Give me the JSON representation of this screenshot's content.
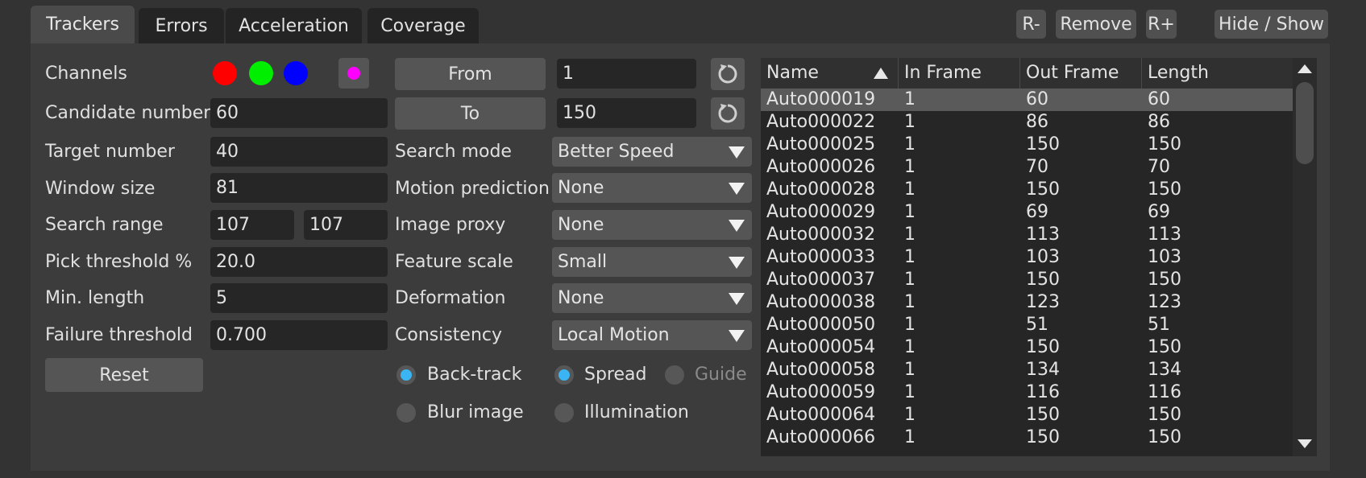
{
  "tabs": [
    {
      "label": "Trackers",
      "active": true
    },
    {
      "label": "Errors",
      "active": false
    },
    {
      "label": "Acceleration",
      "active": false
    },
    {
      "label": "Coverage",
      "active": false
    }
  ],
  "toolbar": {
    "r_minus": "R-",
    "remove": "Remove",
    "r_plus": "R+",
    "hide_show": "Hide / Show"
  },
  "channels": {
    "label": "Channels",
    "colors": [
      "#ff0000",
      "#00ee00",
      "#0000ff"
    ],
    "overlay_color": "#ff00ff"
  },
  "params": {
    "candidate_number": {
      "label": "Candidate number",
      "value": "60"
    },
    "target_number": {
      "label": "Target number",
      "value": "40"
    },
    "window_size": {
      "label": "Window size",
      "value": "81"
    },
    "search_range": {
      "label": "Search range",
      "value_x": "107",
      "value_y": "107"
    },
    "pick_threshold": {
      "label": "Pick threshold %",
      "value": "20.0"
    },
    "min_length": {
      "label": "Min. length",
      "value": "5"
    },
    "failure_threshold": {
      "label": "Failure threshold",
      "value": "0.700"
    },
    "reset_label": "Reset"
  },
  "range": {
    "from_label": "From",
    "from_value": "1",
    "to_label": "To",
    "to_value": "150",
    "refresh_icon": "refresh-icon"
  },
  "options": {
    "search_mode": {
      "label": "Search mode",
      "value": "Better Speed"
    },
    "motion_prediction": {
      "label": "Motion prediction",
      "value": "None"
    },
    "image_proxy": {
      "label": "Image proxy",
      "value": "None"
    },
    "feature_scale": {
      "label": "Feature scale",
      "value": "Small"
    },
    "deformation": {
      "label": "Deformation",
      "value": "None"
    },
    "consistency": {
      "label": "Consistency",
      "value": "Local Motion"
    }
  },
  "toggles": {
    "back_track": {
      "label": "Back-track",
      "on": true
    },
    "spread": {
      "label": "Spread",
      "on": true
    },
    "guide": {
      "label": "Guide",
      "on": false
    },
    "blur_image": {
      "label": "Blur image",
      "on": false
    },
    "illumination": {
      "label": "Illumination",
      "on": false
    }
  },
  "tracker_table": {
    "columns": [
      "Name",
      "In Frame",
      "Out Frame",
      "Length"
    ],
    "rows": [
      [
        "Auto000019",
        "1",
        "60",
        "60"
      ],
      [
        "Auto000022",
        "1",
        "86",
        "86"
      ],
      [
        "Auto000025",
        "1",
        "150",
        "150"
      ],
      [
        "Auto000026",
        "1",
        "70",
        "70"
      ],
      [
        "Auto000028",
        "1",
        "150",
        "150"
      ],
      [
        "Auto000029",
        "1",
        "69",
        "69"
      ],
      [
        "Auto000032",
        "1",
        "113",
        "113"
      ],
      [
        "Auto000033",
        "1",
        "103",
        "103"
      ],
      [
        "Auto000037",
        "1",
        "150",
        "150"
      ],
      [
        "Auto000038",
        "1",
        "123",
        "123"
      ],
      [
        "Auto000050",
        "1",
        "51",
        "51"
      ],
      [
        "Auto000054",
        "1",
        "150",
        "150"
      ],
      [
        "Auto000058",
        "1",
        "134",
        "134"
      ],
      [
        "Auto000059",
        "1",
        "116",
        "116"
      ],
      [
        "Auto000064",
        "1",
        "150",
        "150"
      ],
      [
        "Auto000066",
        "1",
        "150",
        "150"
      ]
    ],
    "selected_row": 0
  }
}
